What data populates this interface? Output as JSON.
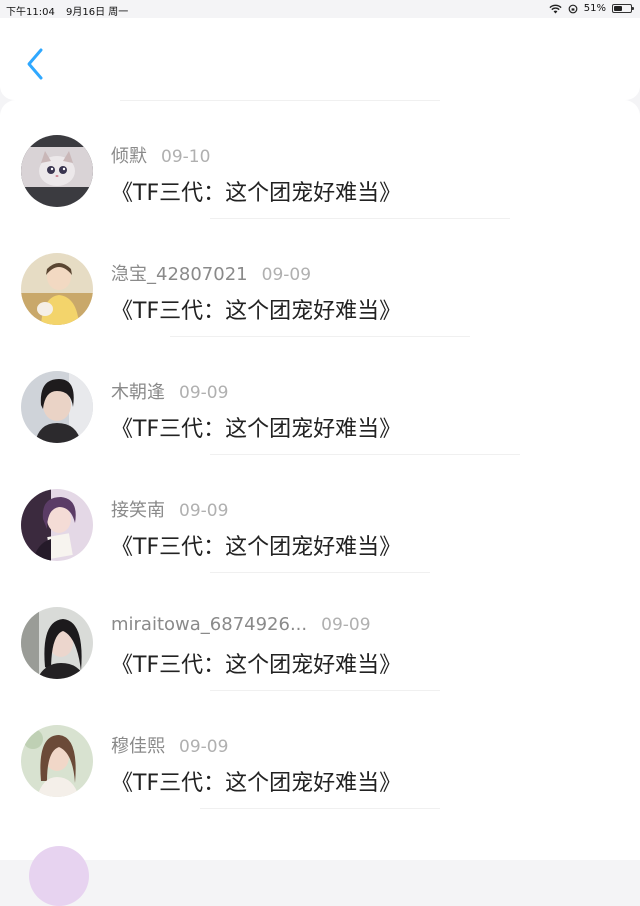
{
  "status_bar": {
    "time": "下午11:04",
    "date": "9月16日 周一",
    "battery": "51%",
    "battery_level": 0.51
  },
  "nav": {
    "back_icon": "chevron-left-icon",
    "accent": "#2fa8ff"
  },
  "items": [
    {
      "name": "倾默",
      "date": "09-10",
      "title": "《TF三代：这个团宠好难当》",
      "avatar": "kitten"
    },
    {
      "name": "㴔宝_42807021",
      "date": "09-09",
      "title": "《TF三代：这个团宠好难当》",
      "avatar": "boy-yellow"
    },
    {
      "name": "木朝逢",
      "date": "09-09",
      "title": "《TF三代：这个团宠好难当》",
      "avatar": "boy-dark"
    },
    {
      "name": "接笑南",
      "date": "09-09",
      "title": "《TF三代：这个团宠好难当》",
      "avatar": "anime"
    },
    {
      "name": "miraitowa_6874926...",
      "date": "09-09",
      "title": "《TF三代：这个团宠好难当》",
      "avatar": "girl-dark"
    },
    {
      "name": "穆佳熙",
      "date": "09-09",
      "title": "《TF三代：这个团宠好难当》",
      "avatar": "girl-light"
    }
  ]
}
